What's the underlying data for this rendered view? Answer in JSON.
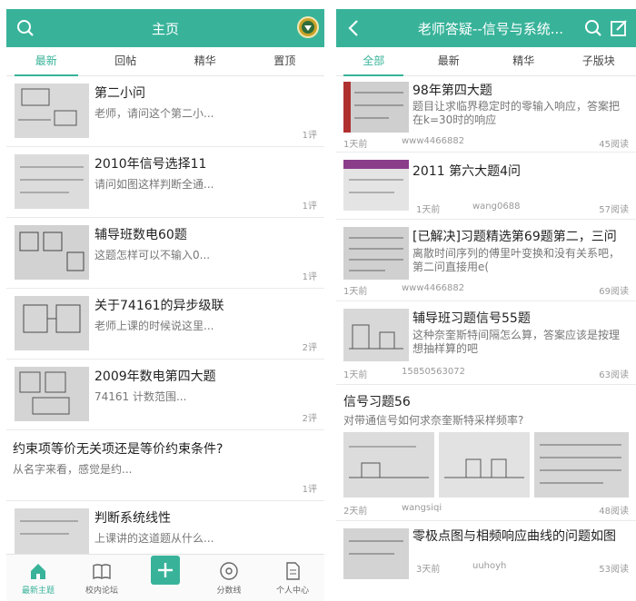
{
  "left": {
    "header": {
      "title": "主页"
    },
    "tabs": [
      "最新",
      "回帖",
      "精华",
      "置顶"
    ],
    "items": [
      {
        "title": "第二小问",
        "subtitle": "老师，请问这个第二小...",
        "count": "1评"
      },
      {
        "title": "2010年信号选择11",
        "subtitle": "请问如图这样判断全通...",
        "count": "1评"
      },
      {
        "title": "辅导班数电60题",
        "subtitle": "这题怎样可以不输入0...",
        "count": "1评"
      },
      {
        "title": "关于74161的异步级联",
        "subtitle": "老师上课的时候说这里...",
        "count": "2评"
      },
      {
        "title": "2009年数电第四大题",
        "subtitle": "74161 计数范围...",
        "count": "2评"
      },
      {
        "title": "约束项等价无关项还是等价约束条件?",
        "subtitle": "从名字来看，感觉是约...",
        "count": "1评"
      },
      {
        "title": "判断系统线性",
        "subtitle": "上课讲的这道题从什么...",
        "count": ""
      }
    ],
    "nav": [
      {
        "label": "最新主题",
        "icon": "home-icon"
      },
      {
        "label": "校内论坛",
        "icon": "book-icon"
      },
      {
        "label": "",
        "icon": "plus-icon"
      },
      {
        "label": "分数线",
        "icon": "disc-icon"
      },
      {
        "label": "个人中心",
        "icon": "document-icon"
      }
    ]
  },
  "right": {
    "header": {
      "title": "老师答疑--信号与系统..."
    },
    "tabs": [
      "全部",
      "最新",
      "精华",
      "子版块"
    ],
    "items": [
      {
        "title": "98年第四大题",
        "subtitle": "题目让求临界稳定时的零输入响应，答案把在k=30时的响应",
        "time": "1天前",
        "user": "www4466882",
        "reads": "45阅读"
      },
      {
        "title": "2011 第六大题4问",
        "subtitle": "",
        "time": "1天前",
        "user": "wang0688",
        "reads": "57阅读"
      },
      {
        "title": "[已解决]习题精选第69题第二，三问",
        "subtitle": "离散时间序列的傅里叶变换和没有关系吧，第二问直接用e(",
        "time": "1天前",
        "user": "www4466882",
        "reads": "69阅读"
      },
      {
        "title": "辅导班习题信号55题",
        "subtitle": "这种奈奎斯特间隔怎么算，答案应该是按理想抽样算的吧",
        "time": "1天前",
        "user": "15850563072",
        "reads": "63阅读"
      },
      {
        "title": "信号习题56",
        "subtitle": "对带通信号如何求奈奎斯特采样频率?",
        "time": "2天前",
        "user": "wangsiqi",
        "reads": "48阅读"
      },
      {
        "title": "零极点图与相频响应曲线的问题如图",
        "subtitle": "",
        "time": "3天前",
        "user": "uuhoyh",
        "reads": "53阅读"
      }
    ]
  },
  "colors": {
    "accent": "#38b39a"
  }
}
